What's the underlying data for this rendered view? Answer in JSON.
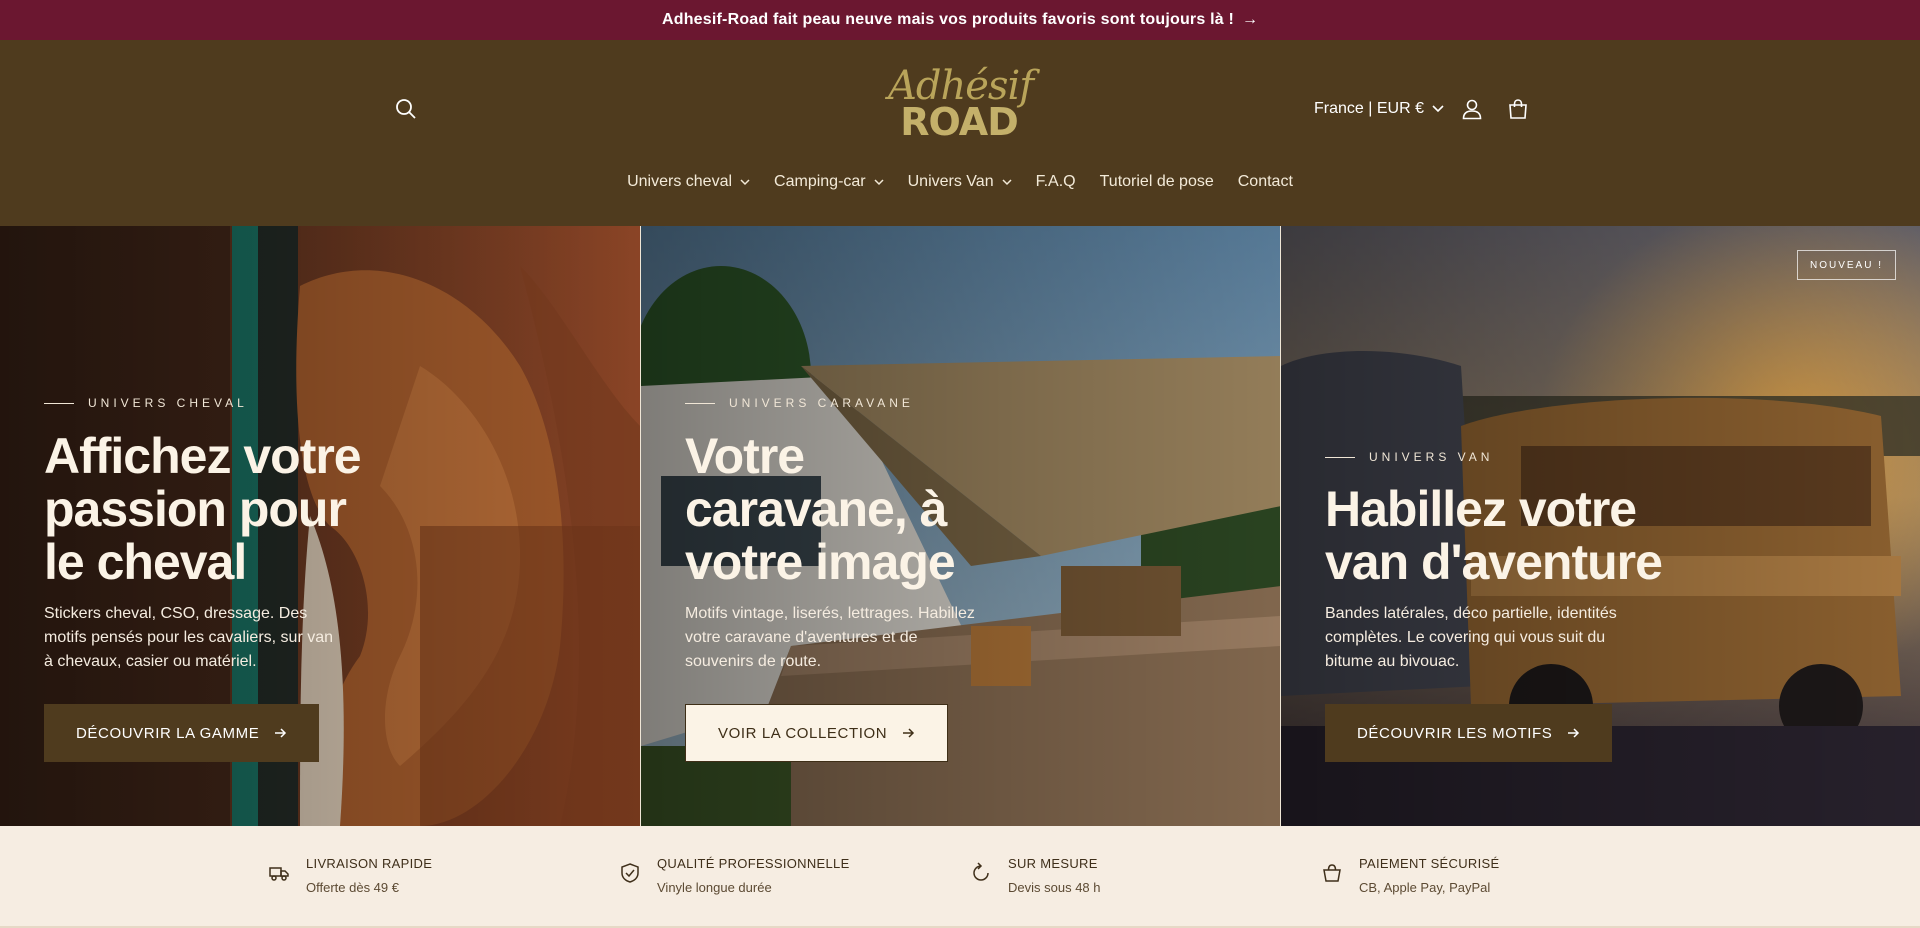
{
  "announcement": {
    "text": "Adhesif-Road fait peau neuve mais vos produits favoris sont toujours là !",
    "arrow": "→"
  },
  "header": {
    "logo_top": "Adhésif",
    "logo_bottom": "ROAD",
    "locale": "France | EUR €",
    "icons": {
      "search": "search-icon",
      "account": "user-icon",
      "cart": "cart-icon"
    }
  },
  "nav": {
    "items": [
      {
        "label": "Univers cheval",
        "dropdown": true
      },
      {
        "label": "Camping-car",
        "dropdown": true
      },
      {
        "label": "Univers Van",
        "dropdown": true
      },
      {
        "label": "F.A.Q",
        "dropdown": false
      },
      {
        "label": "Tutoriel de pose",
        "dropdown": false
      },
      {
        "label": "Contact",
        "dropdown": false
      }
    ]
  },
  "hero": {
    "panels": [
      {
        "eyebrow": "UNIVERS CHEVAL",
        "title": "Affichez votre passion pour le cheval",
        "desc": "Stickers cheval, CSO, dressage. Des motifs pensés pour les cavaliers, sur van à chevaux, casier ou matériel.",
        "cta": "DÉCOUVRIR LA GAMME"
      },
      {
        "eyebrow": "UNIVERS CARAVANE",
        "title": "Votre caravane, à votre image",
        "desc": "Motifs vintage, liserés, lettrages. Habillez votre caravane d'aventures et de souvenirs de route.",
        "cta": "VOIR LA COLLECTION"
      },
      {
        "eyebrow": "UNIVERS VAN",
        "title": "Habillez votre van d'aventure",
        "desc": "Bandes latérales, déco partielle, identités complètes. Le covering qui vous suit du bitume au bivouac.",
        "cta": "DÉCOUVRIR LES MOTIFS",
        "badge": "NOUVEAU !"
      }
    ]
  },
  "features": [
    {
      "title": "LIVRAISON RAPIDE",
      "sub": "Offerte dès 49 €",
      "icon": "truck-icon"
    },
    {
      "title": "QUALITÉ PROFESSIONNELLE",
      "sub": "Vinyle longue durée",
      "icon": "shield-check-icon"
    },
    {
      "title": "SUR MESURE",
      "sub": "Devis sous 48 h",
      "icon": "refresh-icon"
    },
    {
      "title": "PAIEMENT SÉCURISÉ",
      "sub": "CB, Apple Pay, PayPal",
      "icon": "bag-icon"
    }
  ],
  "colors": {
    "announcement_bg": "#6b1730",
    "header_bg": "#4f3b1e",
    "cream": "#f6ede2",
    "logo_gold": "#c4b06a"
  }
}
